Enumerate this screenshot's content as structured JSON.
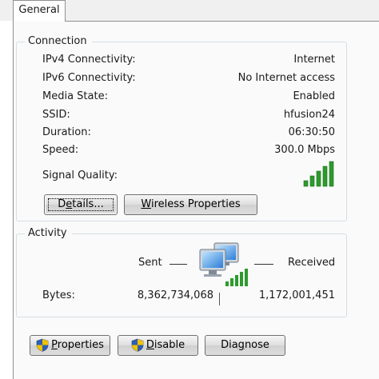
{
  "tabs": [
    {
      "label": "General"
    }
  ],
  "connection": {
    "title": "Connection",
    "rows": [
      {
        "label": "IPv4 Connectivity:",
        "value": "Internet"
      },
      {
        "label": "IPv6 Connectivity:",
        "value": "No Internet access"
      },
      {
        "label": "Media State:",
        "value": "Enabled"
      },
      {
        "label": "SSID:",
        "value": "hfusion24"
      },
      {
        "label": "Duration:",
        "value": "06:30:50"
      },
      {
        "label": "Speed:",
        "value": "300.0 Mbps"
      }
    ],
    "signal_label": "Signal Quality:",
    "signal_bars": 5,
    "signal_bars_total": 5,
    "buttons": {
      "details_pre": "D",
      "details_u": "e",
      "details_post": "tails...",
      "wireless_u": "W",
      "wireless_post": "ireless Properties"
    }
  },
  "activity": {
    "title": "Activity",
    "sent_label": "Sent",
    "received_label": "Received",
    "bytes_label": "Bytes:",
    "bytes_sent": "8,362,734,068",
    "bytes_received": "1,172,001,451"
  },
  "bottom_buttons": {
    "properties_u": "P",
    "properties_post": "roperties",
    "disable_u": "D",
    "disable_post": "isable",
    "diagnose_pre": "Dia",
    "diagnose_u": "g",
    "diagnose_post": "nose"
  },
  "colors": {
    "signal_green": "#2e9a2e",
    "group_border": "#d5dfe5",
    "tab_border": "#8e8f8f",
    "shield_blue": "#2f5fb5",
    "shield_yellow": "#f2c200"
  }
}
